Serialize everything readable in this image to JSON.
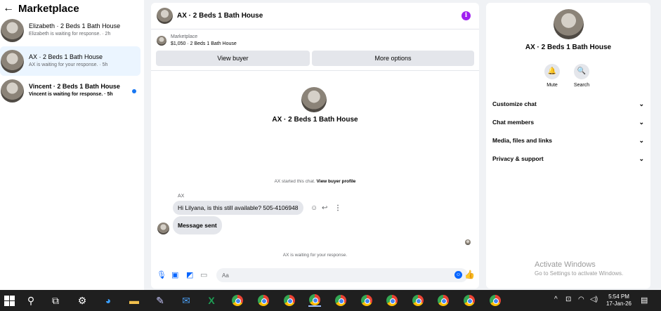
{
  "sidebar": {
    "back_icon": "arrow-left-icon",
    "title": "Marketplace",
    "conversations": [
      {
        "name": "Elizabeth · 2 Beds 1 Bath House",
        "status": "Elizabeth is waiting for response. · 2h",
        "active": false,
        "unread": false
      },
      {
        "name": "AX · 2 Beds 1 Bath House",
        "status": "AX is waiting for your response. · 5h",
        "active": true,
        "unread": false
      },
      {
        "name": "Vincent · 2 Beds 1 Bath House",
        "status": "Vincent is waiting for response. · 5h",
        "active": false,
        "unread": true
      }
    ]
  },
  "chat": {
    "header_title": "AX · 2 Beds 1 Bath House",
    "info_icon": "i",
    "listing_label": "Marketplace",
    "listing_price": "$1,050 · 2 Beds 1 Bath House",
    "view_buyer": "View buyer",
    "more_options": "More options",
    "center_title": "AX · 2 Beds 1 Bath House",
    "started_text": "AX started this chat.",
    "view_buyer_profile": "View buyer profile",
    "sender": "AX",
    "message1": "Hi Lilyana, is this still available? 505-4106948",
    "message2": "Message sent",
    "waiting": "AX is waiting for your response.",
    "composer_placeholder": "Aa"
  },
  "right_panel": {
    "title": "AX · 2 Beds 1 Bath House",
    "mute_label": "Mute",
    "search_label": "Search",
    "rows": [
      "Customize chat",
      "Chat members",
      "Media, files and links",
      "Privacy & support"
    ],
    "watermark_title": "Activate Windows",
    "watermark_sub": "Go to Settings to activate Windows."
  },
  "taskbar": {
    "time": "5:54 PM",
    "date": "17-Jan-26"
  },
  "colors": {
    "accent": "#0866ff",
    "unread_dot": "#1877f2",
    "active_bg": "#ebf5ff",
    "info": "#a020f0"
  }
}
